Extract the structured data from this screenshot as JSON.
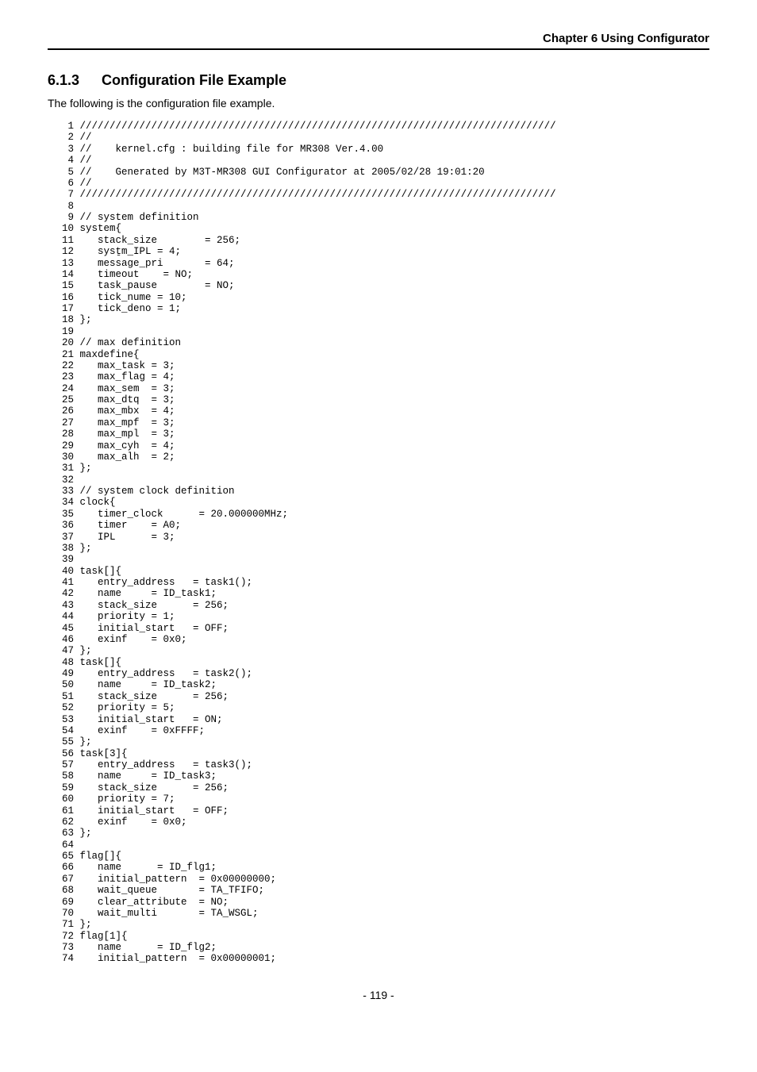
{
  "chapter_header": "Chapter 6 Using Configurator",
  "section": {
    "number": "6.1.3",
    "title": "Configuration File Example"
  },
  "intro": "The following is the configuration file example.",
  "code": " 1 ////////////////////////////////////////////////////////////////////////////////\n 2 //\n 3 //    kernel.cfg : building file for MR308 Ver.4.00\n 4 //\n 5 //    Generated by M3T-MR308 GUI Configurator at 2005/02/28 19:01:20\n 6 //\n 7 ////////////////////////////////////////////////////////////////////////////////\n 8\n 9 // system definition\n10 system{\n11    stack_size        = 256;\n12    sysṯm_IPL = 4;\n13    message_pri       = 64;\n14    timeout    = NO;\n15    task_pause        = NO;\n16    tick_nume = 10;\n17    tick_deno = 1;\n18 };\n19\n20 // max definition\n21 maxdefine{\n22    max_task = 3;\n23    max_flag = 4;\n24    max_sem  = 3;\n25    max_dtq  = 3;\n26    max_mbx  = 4;\n27    max_mpf  = 3;\n28    max_mpl  = 3;\n29    max_cyh  = 4;\n30    max_alh  = 2;\n31 };\n32\n33 // system clock definition\n34 clock{\n35    timer_clock      = 20.000000MHz;\n36    timer    = A0;\n37    IPL      = 3;\n38 };\n39\n40 task[]{\n41    entry_address   = task1();\n42    name     = ID_task1;\n43    stack_size      = 256;\n44    priority = 1;\n45    initial_start   = OFF;\n46    exinf    = 0x0;\n47 };\n48 task[]{\n49    entry_address   = task2();\n50    name     = ID_task2;\n51    stack_size      = 256;\n52    priority = 5;\n53    initial_start   = ON;\n54    exinf    = 0xFFFF;\n55 };\n56 task[3]{\n57    entry_address   = task3();\n58    name     = ID_task3;\n59    stack_size      = 256;\n60    priority = 7;\n61    initial_start   = OFF;\n62    exinf    = 0x0;\n63 };\n64\n65 flag[]{\n66    name      = ID_flg1;\n67    initial_pattern  = 0x00000000;\n68    wait_queue       = TA_TFIFO;\n69    clear_attribute  = NO;\n70    wait_multi       = TA_WSGL;\n71 };\n72 flag[1]{\n73    name      = ID_flg2;\n74    initial_pattern  = 0x00000001;",
  "page_number": "- 119 -"
}
